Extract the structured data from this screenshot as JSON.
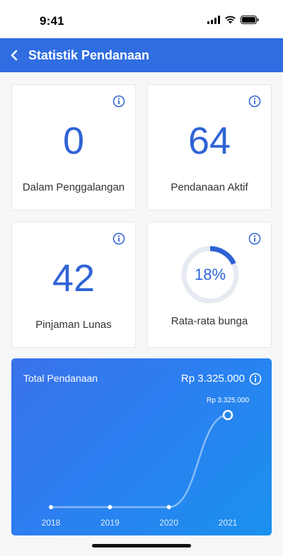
{
  "status_bar": {
    "time": "9:41"
  },
  "header": {
    "title": "Statistik Pendanaan",
    "back_icon": "chevron-left-icon"
  },
  "stats": [
    {
      "value": "0",
      "label": "Dalam Penggalangan"
    },
    {
      "value": "64",
      "label": "Pendanaan Aktif"
    },
    {
      "value": "42",
      "label": "Pinjaman Lunas"
    },
    {
      "value": "18%",
      "label": "Rata-rata bunga",
      "percent": 18
    }
  ],
  "total_panel": {
    "title": "Total Pendanaan",
    "total": "Rp 3.325.000",
    "point_label": "Rp 3.325.000"
  },
  "chart_data": {
    "type": "line",
    "x": [
      "2018",
      "2019",
      "2020",
      "2021"
    ],
    "series": [
      {
        "values": [
          0,
          0,
          0,
          3325000
        ]
      }
    ],
    "annotations": [
      "Rp 3.325.000"
    ],
    "grid": false
  },
  "colors": {
    "primary": "#2f6de1",
    "value_text": "#2f63d6",
    "ring_track": "#e6eaf2"
  }
}
